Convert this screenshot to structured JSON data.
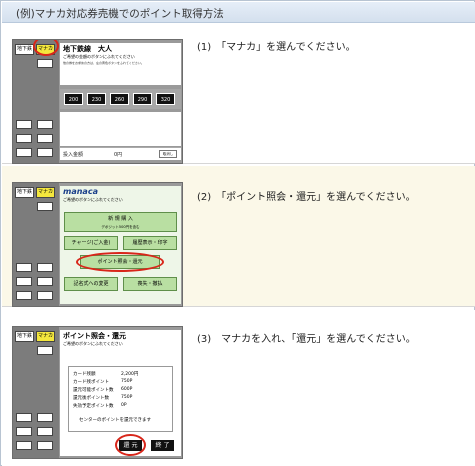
{
  "header": {
    "title": "(例)マナカ対応券売機でのポイント取得方法"
  },
  "steps": [
    {
      "text": "(1)　「マナカ」を選んでください。"
    },
    {
      "text": "(2)　「ポイント照会・還元」を選んでください。"
    },
    {
      "text": "(3)　マナカを入れ、「還元」を選んでください。"
    }
  ],
  "machine": {
    "tab_left": "地下鉄",
    "tab_right": "マナカ"
  },
  "screen1": {
    "title": "地下鉄線　大人",
    "subtitle": "ご希望の金額のボタンにふれてください",
    "note": "他の券をお求めの方は、左の黄色ボタンをふれてください。",
    "fares": [
      "200",
      "230",
      "260",
      "290",
      "320"
    ],
    "amount_label": "投入金額",
    "amount_value": "0円",
    "cancel": "取消し"
  },
  "screen2": {
    "logo": "manaca",
    "subtitle": "ご希望のボタンにふれてください",
    "buttons": {
      "new_purchase": "新 規 購 入",
      "new_purchase_sub": "デポジット500円を含む",
      "charge": "チャージ(ご入金)",
      "history": "履歴表示・印字",
      "points": "ポイント照会・還元",
      "registration": "記名式への変更",
      "reissue": "喪失・撤払"
    }
  },
  "screen3": {
    "title": "ポイント照会・還元",
    "subtitle": "ご希望のボタンにふれてください",
    "rows": [
      {
        "label": "カード残額",
        "value": "2,200円"
      },
      {
        "label": "カード残ポイント",
        "value": "750P"
      },
      {
        "label": "還元可能ポイント数",
        "value": "600P"
      },
      {
        "label": "還元後ポイント数",
        "value": "750P"
      },
      {
        "label": "失効予定ポイント数",
        "value": "0P"
      }
    ],
    "note": "センターのポイントを還元できます",
    "redeem": "還 元",
    "finish": "終 了"
  }
}
